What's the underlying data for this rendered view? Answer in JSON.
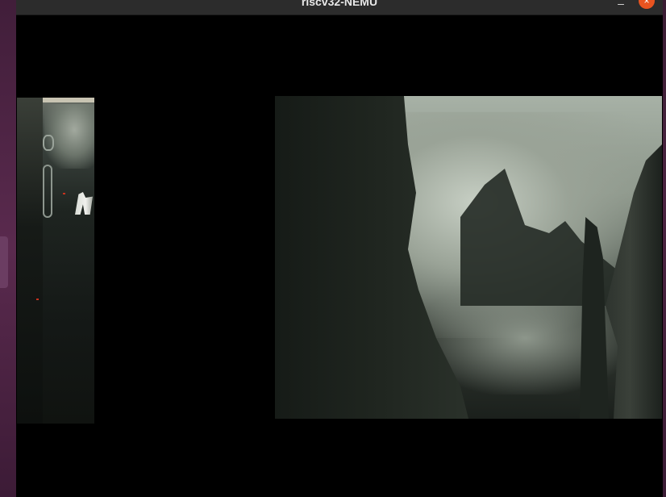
{
  "window": {
    "title": "riscv32-NEMU",
    "minimize_label": "–",
    "close_label": "×"
  },
  "icons": {
    "minimize": "minimize-icon",
    "close": "close-icon"
  },
  "colors": {
    "titlebar": "#2c2c2c",
    "close_button": "#e95420",
    "canvas_background": "#000000",
    "desktop": "#3a1c33"
  }
}
